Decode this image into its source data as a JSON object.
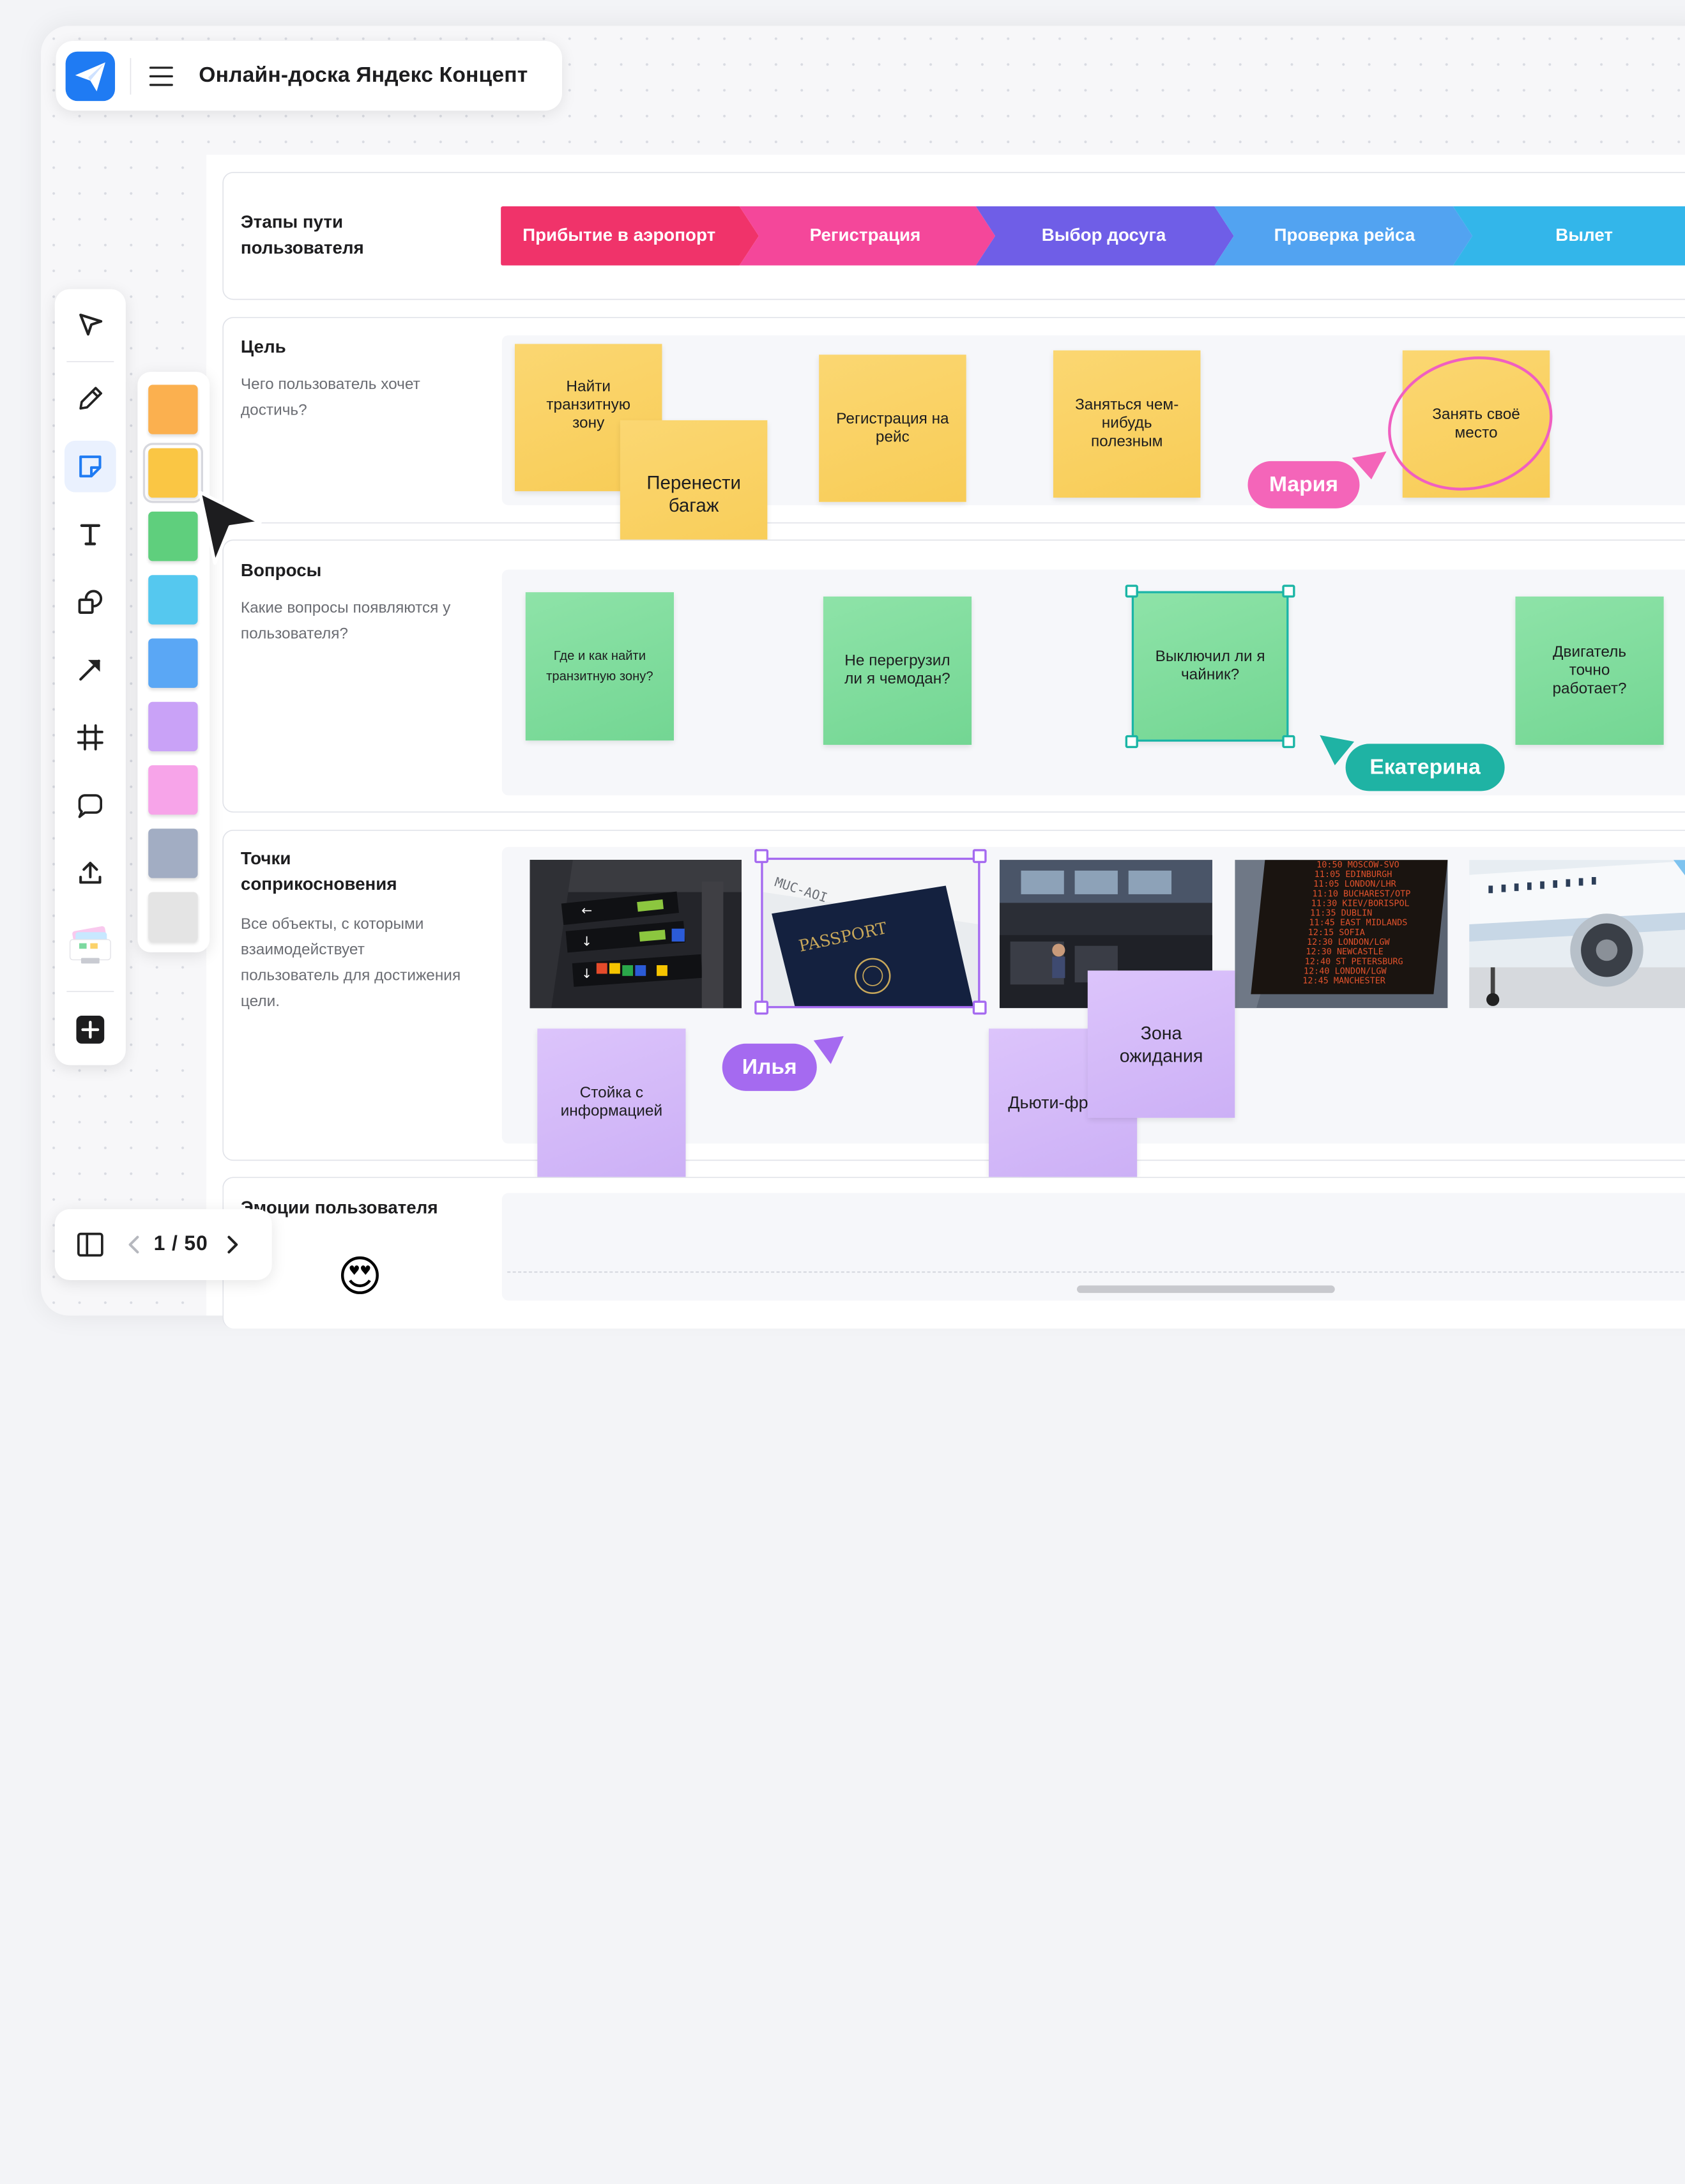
{
  "app": {
    "title": "Онлайн-доска Яндекс Концепт"
  },
  "stages": {
    "title": "Этапы пути пользователя",
    "items": [
      {
        "label": "Прибытие в аэропорт",
        "color": "#f0336a"
      },
      {
        "label": "Регистрация",
        "color": "#f4479a"
      },
      {
        "label": "Выбор досуга",
        "color": "#6f5ee7"
      },
      {
        "label": "Проверка рейса",
        "color": "#52a3f1"
      },
      {
        "label": "Вылет",
        "color": "#33b6ea"
      }
    ]
  },
  "goal": {
    "title": "Цель",
    "description": "Чего пользователь хочет достичь?",
    "notes": [
      "Найти транзитную зону",
      "Перенести багаж",
      "Регистрация на рейс",
      "Заняться чем-нибудь полезным",
      "Занять своё место"
    ]
  },
  "questions": {
    "title": "Вопросы",
    "description": "Какие вопросы появляются у пользователя?",
    "notes": [
      "Где и как найти транзитную зону?",
      "Не перегрузил ли я чемодан?",
      "Выключил ли я чайник?",
      "Двигатель точно работает?"
    ]
  },
  "touchpoints": {
    "title": "Точки соприкосновения",
    "description": "Все объекты, с которыми взаимодействует пользователь для достижения цели.",
    "photos": [
      {
        "name": "airport-signs-photo"
      },
      {
        "name": "passport-photo",
        "text_1": "MUC-AOI",
        "text_2": "PASSPORT"
      },
      {
        "name": "waiting-hall-photo"
      },
      {
        "name": "departures-board-photo",
        "lines": [
          "10:50 MOSCOW-SVO",
          "11:05 EDINBURGH",
          "11:05 LONDON/LHR",
          "11:10 BUCHAREST/OTP",
          "11:30 KIEV/BORISPOL",
          "11:35 DUBLIN",
          "11:45 EAST MIDLANDS",
          "12:15 SOFIA",
          "12:30 LONDON/LGW",
          "12:30 NEWCASTLE",
          "12:40 ST PETERSBURG",
          "12:40 LONDON/LGW",
          "12:45 MANCHESTER"
        ]
      },
      {
        "name": "airplane-photo"
      }
    ],
    "notes": [
      "Стойка с информацией",
      "Дьюти-фри",
      "Зона ожидания"
    ]
  },
  "emotions": {
    "title": "Эмоции пользователя"
  },
  "collaborators": [
    {
      "name": "Мария",
      "color": "#f465b9"
    },
    {
      "name": "Екатерина",
      "color": "#1fb3a4"
    },
    {
      "name": "Илья",
      "color": "#a56af0"
    }
  ],
  "palette": [
    "#fbb04f",
    "#fac644",
    "#5fcf7d",
    "#55c8ef",
    "#5aa7f5",
    "#c9a2f7",
    "#f7a4e9",
    "#a2adc3",
    "#e4e4e4"
  ],
  "pager": {
    "count": "1 / 50"
  },
  "emoji": {
    "face": "😍"
  }
}
